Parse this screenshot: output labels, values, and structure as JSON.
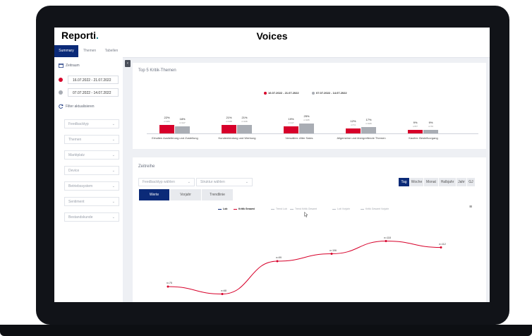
{
  "app": {
    "brand": "Reporti",
    "brand_dot": ".",
    "title": "Voices"
  },
  "tabs": [
    {
      "label": "Summary",
      "active": true
    },
    {
      "label": "Themen",
      "active": false
    },
    {
      "label": "Tabellen",
      "active": false
    }
  ],
  "sidebar": {
    "zeitraum_label": "Zeitraum",
    "date_ranges": [
      {
        "label": "16.07.2022 - 21.07.2022",
        "color": "#d7002a"
      },
      {
        "label": "07.07.2022 - 14.07.2022",
        "color": "#a9adb4"
      }
    ],
    "filter_label": "Filter aktualisieren",
    "filters": [
      "Feedbacktyp",
      "Themen",
      "Marktplatz",
      "Device",
      "Betriebssystem",
      "Sentiment",
      "Bestandskunde"
    ]
  },
  "top5": {
    "title": "Top 5 Kritik-Themen",
    "legend": [
      {
        "label": "16.07.2022 - 21.07.2022",
        "color": "#d7002a"
      },
      {
        "label": "07.07.2022 - 14.07.2022",
        "color": "#a9adb4"
      }
    ],
    "categories": [
      {
        "name": "Erhalten Auslieferung und Zustellung",
        "cur_pct": "22%",
        "cur_n": "n=184",
        "prev_pct": "18%",
        "prev_n": "n=147"
      },
      {
        "name": "Kundenbindung und Werbung",
        "cur_pct": "21%",
        "cur_n": "n=128",
        "prev_pct": "21%",
        "prev_n": "n=136"
      },
      {
        "name": "Verwalten: After Sales",
        "cur_pct": "19%",
        "cur_n": "n=117",
        "prev_pct": "25%",
        "prev_n": "n=165"
      },
      {
        "name": "Allgemeine und übergreifende Themen",
        "cur_pct": "12%",
        "cur_n": "n=74",
        "prev_pct": "17%",
        "prev_n": "n=106"
      },
      {
        "name": "Kaufen: Bestellvorgang",
        "cur_pct": "9%",
        "cur_n": "n=57",
        "prev_pct": "9%",
        "prev_n": "n=70"
      }
    ]
  },
  "chart_data": [
    {
      "type": "bar",
      "title": "Top 5 Kritik-Themen",
      "categories": [
        "Erhalten Auslieferung und Zustellung",
        "Kundenbindung und Werbung",
        "Verwalten: After Sales",
        "Allgemeine und übergreifende Themen",
        "Kaufen: Bestellvorgang"
      ],
      "series": [
        {
          "name": "16.07.2022 - 21.07.2022",
          "values": [
            22,
            21,
            19,
            12,
            9
          ],
          "color": "#d7002a"
        },
        {
          "name": "07.07.2022 - 14.07.2022",
          "values": [
            18,
            21,
            25,
            17,
            9
          ],
          "color": "#a9adb4"
        }
      ],
      "ylim": [
        0,
        30
      ],
      "legend": "top-center"
    },
    {
      "type": "line",
      "title": "Zeitreihe",
      "x": [
        1,
        2,
        3,
        4,
        5,
        6
      ],
      "series": [
        {
          "name": "Kritik Gesamt",
          "values": [
            75,
            68,
            99,
            106,
            118,
            112
          ],
          "color": "#d7002a"
        }
      ],
      "point_labels": [
        "n=75",
        "n=68",
        "n=99",
        "n=106",
        "n=118",
        "n=112"
      ],
      "ylim": [
        55,
        125
      ],
      "legend": "top-center"
    }
  ],
  "zeitreihe": {
    "title": "Zeitreihe",
    "select1": "Feedbacktyp wählen",
    "select2": "Struktur wählen",
    "toggles": [
      {
        "label": "Werte",
        "active": true
      },
      {
        "label": "Vorjahr",
        "active": false
      },
      {
        "label": "Trendlinie",
        "active": false
      }
    ],
    "periods": [
      {
        "label": "Tag",
        "active": true
      },
      {
        "label": "Woche",
        "active": false
      },
      {
        "label": "Monat",
        "active": false
      },
      {
        "label": "Halbjahr",
        "active": false
      },
      {
        "label": "Jahr",
        "active": false
      },
      {
        "label": "GJ",
        "active": false
      }
    ],
    "legend": [
      {
        "label": "Lob",
        "color": "#0b2a78",
        "bold": true
      },
      {
        "label": "Kritik Gesamt",
        "color": "#d7002a",
        "bold": true
      },
      {
        "label": "Trend Lob",
        "color": "#b8bcc4",
        "bold": false
      },
      {
        "label": "Trend Kritik Gesamt",
        "color": "#b8bcc4",
        "bold": false
      },
      {
        "label": "Lob Vorjahr",
        "color": "#b8bcc4",
        "bold": false
      },
      {
        "label": "Kritik Gesamt Vorjahr",
        "color": "#b8bcc4",
        "bold": false
      }
    ]
  },
  "icons": {
    "calendar": "calendar-icon",
    "refresh": "refresh-icon",
    "collapse": "chevron-left-icon",
    "menu": "hamburger-icon"
  }
}
